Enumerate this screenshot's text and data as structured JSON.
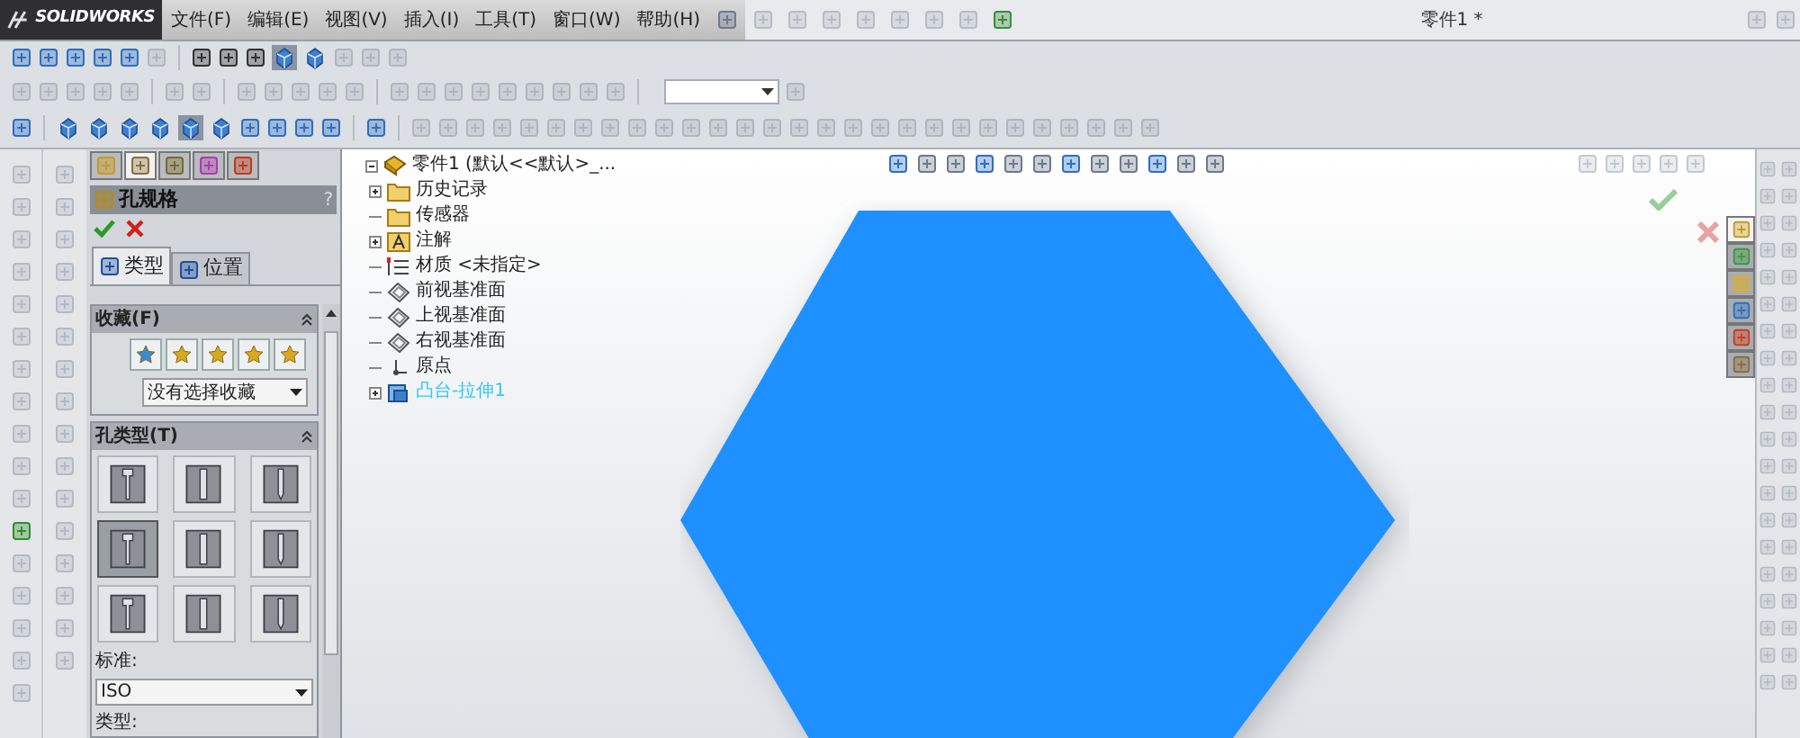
{
  "app": {
    "logo": "SOLIDWORKS",
    "menu": [
      "文件(F)",
      "编辑(E)",
      "视图(V)",
      "插入(I)",
      "工具(T)",
      "窗口(W)",
      "帮助(H)"
    ],
    "title": "零件1 *"
  },
  "property_manager": {
    "manager_tabs": [
      {
        "selected": false
      },
      {
        "selected": true
      },
      {
        "selected": false
      },
      {
        "selected": false
      },
      {
        "selected": false
      }
    ],
    "title": "孔规格",
    "help": "?",
    "tabs": [
      {
        "label": "类型",
        "selected": true
      },
      {
        "label": "位置",
        "selected": false
      }
    ],
    "favorites": {
      "title": "收藏(F)",
      "selection": "没有选择收藏"
    },
    "hole_type": {
      "title": "孔类型(T)",
      "types": [
        {
          "selected": false
        },
        {
          "selected": false
        },
        {
          "selected": false
        },
        {
          "selected": true
        },
        {
          "selected": false
        },
        {
          "selected": false
        },
        {
          "selected": false
        },
        {
          "selected": false
        },
        {
          "selected": false
        }
      ],
      "standard_label": "标准:",
      "standard": "ISO",
      "type_label": "类型:"
    }
  },
  "feature_tree": {
    "root": "零件1  (默认<<默认>_...",
    "items": [
      {
        "kind": "history",
        "label": "历史记录",
        "expandable": true,
        "selected": false
      },
      {
        "kind": "sensor",
        "label": "传感器",
        "expandable": false,
        "selected": false
      },
      {
        "kind": "annotation",
        "label": "注解",
        "expandable": true,
        "selected": false
      },
      {
        "kind": "material",
        "label": "材质 <未指定>",
        "expandable": false,
        "selected": false
      },
      {
        "kind": "plane",
        "label": "前视基准面",
        "expandable": false,
        "selected": false
      },
      {
        "kind": "plane",
        "label": "上视基准面",
        "expandable": false,
        "selected": false
      },
      {
        "kind": "plane",
        "label": "右视基准面",
        "expandable": false,
        "selected": false
      },
      {
        "kind": "origin",
        "label": "原点",
        "expandable": false,
        "selected": false
      },
      {
        "kind": "feature",
        "label": "凸台-拉伸1",
        "expandable": true,
        "selected": true
      }
    ]
  },
  "task_pane": {
    "tabs": [
      {
        "selected": true
      },
      {
        "selected": false
      },
      {
        "selected": false
      },
      {
        "selected": false
      },
      {
        "selected": false
      },
      {
        "selected": false
      }
    ]
  }
}
